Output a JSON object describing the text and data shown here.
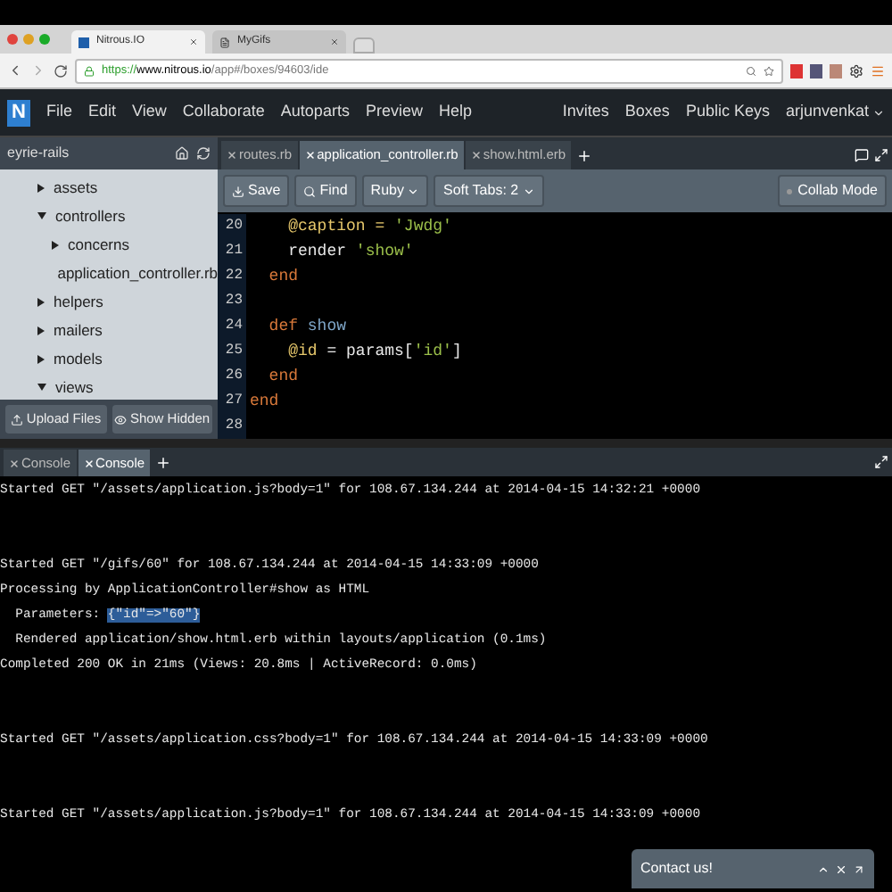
{
  "browser": {
    "tabs": [
      {
        "title": "Nitrous.IO",
        "kind": "logo",
        "selected": true
      },
      {
        "title": "MyGifs",
        "kind": "page",
        "selected": false
      }
    ],
    "url_secure": "https://",
    "url_host": "www.nitrous.io",
    "url_path": "/app#/boxes/94603/ide"
  },
  "menubar": {
    "logo": "N",
    "items": [
      "File",
      "Edit",
      "View",
      "Collaborate",
      "Autoparts",
      "Preview",
      "Help"
    ],
    "right_items": [
      "Invites",
      "Boxes",
      "Public Keys"
    ],
    "user": "arjunvenkat"
  },
  "sidebar": {
    "title": "eyrie-rails",
    "tree": [
      {
        "name": "assets",
        "kind": "folder",
        "expanded": false
      },
      {
        "name": "controllers",
        "kind": "folder",
        "expanded": true,
        "children": [
          {
            "name": "concerns",
            "kind": "folder",
            "expanded": false
          },
          {
            "name": "application_controller.rb",
            "kind": "file",
            "expanded": false
          }
        ]
      },
      {
        "name": "helpers",
        "kind": "folder",
        "expanded": false
      },
      {
        "name": "mailers",
        "kind": "folder",
        "expanded": false
      },
      {
        "name": "models",
        "kind": "folder",
        "expanded": false
      },
      {
        "name": "views",
        "kind": "folder",
        "expanded": true
      }
    ],
    "buttons": [
      "Upload Files",
      "Show Hidden"
    ]
  },
  "editor": {
    "tabs": [
      {
        "title": "routes.rb",
        "selected": false
      },
      {
        "title": "application_controller.rb",
        "selected": true
      },
      {
        "title": "show.html.erb",
        "selected": false
      }
    ],
    "toolbar": [
      "Save",
      "Find"
    ],
    "language": "Ruby",
    "soft_tabs": "Soft Tabs: 2",
    "collab": "Collab Mode",
    "lines": [
      {
        "num": "20",
        "tokens": [
          {
            "kind": "ivar",
            "text": "    @caption = "
          },
          {
            "kind": "string",
            "text": "'Jwdg'"
          }
        ]
      },
      {
        "num": "21",
        "tokens": [
          {
            "kind": "plain",
            "text": "    render "
          },
          {
            "kind": "string",
            "text": "'show'"
          }
        ]
      },
      {
        "num": "22",
        "tokens": [
          {
            "kind": "keyword",
            "text": "  end"
          }
        ]
      },
      {
        "num": "23"
      },
      {
        "num": "24",
        "tokens": [
          {
            "kind": "keyword",
            "text": "  def "
          },
          {
            "kind": "method",
            "text": "show"
          }
        ]
      },
      {
        "num": "25",
        "tokens": [
          {
            "kind": "ivar",
            "text": "    @id"
          },
          {
            "kind": "plain",
            "text": " = params["
          },
          {
            "kind": "string",
            "text": "'id'"
          },
          {
            "kind": "plain",
            "text": "]"
          }
        ]
      },
      {
        "num": "26",
        "tokens": [
          {
            "kind": "keyword",
            "text": "  end"
          }
        ]
      },
      {
        "num": "27",
        "tokens": [
          {
            "kind": "keyword",
            "text": "end"
          }
        ]
      },
      {
        "num": "28"
      }
    ]
  },
  "console": {
    "tabs": [
      {
        "title": "Console",
        "selected": false
      },
      {
        "title": "Console",
        "selected": true
      }
    ],
    "blocks": [
      {
        "lines": [
          {
            "text": "Started GET \"/assets/application.js?body=1\" for 108.67.134.244 at 2014-04-15 14:32:21 +0000"
          }
        ]
      },
      {
        "lines": [
          {
            "text": "Started GET \"/gifs/60\" for 108.67.134.244 at 2014-04-15 14:33:09 +0000"
          },
          {
            "text": "Processing by ApplicationController#show as HTML"
          },
          {
            "text": "  Parameters: ",
            "highlight": "{\"id\"=>\"60\"}"
          },
          {
            "text": "  Rendered application/show.html.erb within layouts/application (0.1ms)"
          },
          {
            "text": "Completed 200 OK in 21ms (Views: 20.8ms | ActiveRecord: 0.0ms)"
          }
        ]
      },
      {
        "lines": [
          {
            "text": "Started GET \"/assets/application.css?body=1\" for 108.67.134.244 at 2014-04-15 14:33:09 +0000"
          }
        ]
      },
      {
        "lines": [
          {
            "text": "Started GET \"/assets/application.js?body=1\" for 108.67.134.244 at 2014-04-15 14:33:09 +0000"
          }
        ]
      }
    ]
  },
  "contact": {
    "title": "Contact us!"
  }
}
